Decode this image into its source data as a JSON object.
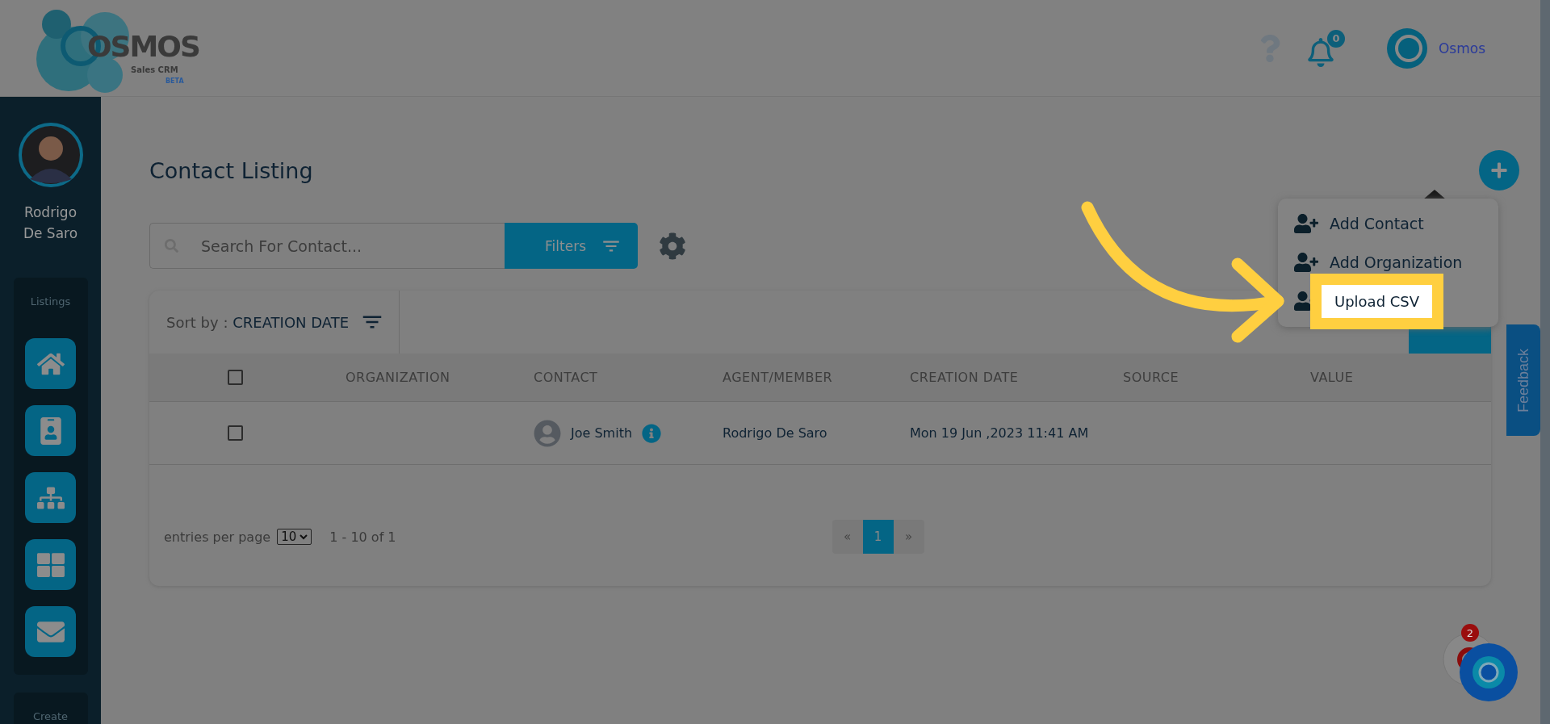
{
  "header": {
    "logo": {
      "word": "OSMOS",
      "subtitle": "Sales CRM",
      "badge": "BETA"
    },
    "notifications": {
      "count": "0"
    },
    "user": {
      "name": "Osmos"
    }
  },
  "sidebar": {
    "user_name": "Rodrigo De Saro",
    "sections": [
      {
        "title": "Listings",
        "items": [
          {
            "kind": "home"
          },
          {
            "kind": "contact"
          },
          {
            "kind": "organization"
          },
          {
            "kind": "grid"
          },
          {
            "kind": "mail"
          }
        ]
      },
      {
        "title": "Create"
      }
    ]
  },
  "page": {
    "title": "Contact Listing",
    "search": {
      "placeholder": "Search For Contact..."
    },
    "filters_button": "Filters"
  },
  "sort": {
    "label": "Sort by :",
    "value": "CREATION DATE"
  },
  "table": {
    "columns": [
      "ORGANIZATION",
      "CONTACT",
      "AGENT/MEMBER",
      "CREATION DATE",
      "SOURCE",
      "VALUE"
    ],
    "rows": [
      {
        "checked": false,
        "organization": "",
        "contact": "Joe Smith",
        "agent": "Rodrigo De Saro",
        "creation_date": "Mon 19 Jun ,2023 11:41 AM",
        "source": "",
        "value": ""
      }
    ],
    "header_checked": false
  },
  "pagination": {
    "entries_label": "entries per page",
    "per_page": "10",
    "range": "1 - 10 of 1",
    "prev": "«",
    "next": "»",
    "pages": [
      {
        "label": "1",
        "selected": true
      }
    ]
  },
  "add_menu": {
    "items": [
      {
        "label": "Add Contact",
        "highlighted": false
      },
      {
        "label": "Add Organization",
        "highlighted": false
      },
      {
        "label": "Upload CSV",
        "highlighted": true
      }
    ]
  },
  "feedback": "Feedback",
  "chat": {
    "badge": "2"
  }
}
